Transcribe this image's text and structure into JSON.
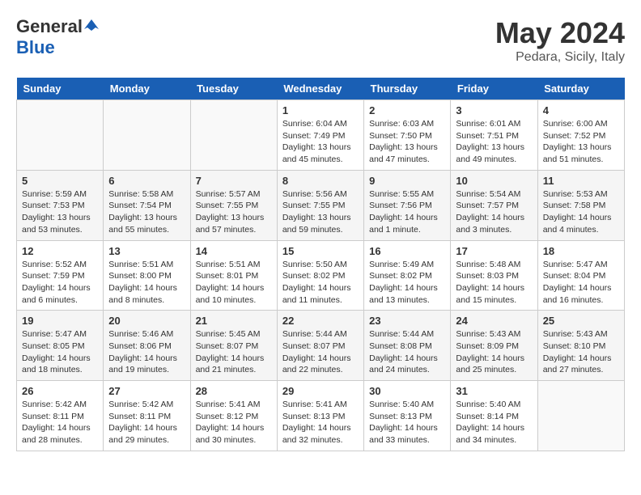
{
  "header": {
    "logo_general": "General",
    "logo_blue": "Blue",
    "title": "May 2024",
    "subtitle": "Pedara, Sicily, Italy"
  },
  "weekdays": [
    "Sunday",
    "Monday",
    "Tuesday",
    "Wednesday",
    "Thursday",
    "Friday",
    "Saturday"
  ],
  "weeks": [
    [
      {
        "day": "",
        "info": ""
      },
      {
        "day": "",
        "info": ""
      },
      {
        "day": "",
        "info": ""
      },
      {
        "day": "1",
        "info": "Sunrise: 6:04 AM\nSunset: 7:49 PM\nDaylight: 13 hours\nand 45 minutes."
      },
      {
        "day": "2",
        "info": "Sunrise: 6:03 AM\nSunset: 7:50 PM\nDaylight: 13 hours\nand 47 minutes."
      },
      {
        "day": "3",
        "info": "Sunrise: 6:01 AM\nSunset: 7:51 PM\nDaylight: 13 hours\nand 49 minutes."
      },
      {
        "day": "4",
        "info": "Sunrise: 6:00 AM\nSunset: 7:52 PM\nDaylight: 13 hours\nand 51 minutes."
      }
    ],
    [
      {
        "day": "5",
        "info": "Sunrise: 5:59 AM\nSunset: 7:53 PM\nDaylight: 13 hours\nand 53 minutes."
      },
      {
        "day": "6",
        "info": "Sunrise: 5:58 AM\nSunset: 7:54 PM\nDaylight: 13 hours\nand 55 minutes."
      },
      {
        "day": "7",
        "info": "Sunrise: 5:57 AM\nSunset: 7:55 PM\nDaylight: 13 hours\nand 57 minutes."
      },
      {
        "day": "8",
        "info": "Sunrise: 5:56 AM\nSunset: 7:55 PM\nDaylight: 13 hours\nand 59 minutes."
      },
      {
        "day": "9",
        "info": "Sunrise: 5:55 AM\nSunset: 7:56 PM\nDaylight: 14 hours\nand 1 minute."
      },
      {
        "day": "10",
        "info": "Sunrise: 5:54 AM\nSunset: 7:57 PM\nDaylight: 14 hours\nand 3 minutes."
      },
      {
        "day": "11",
        "info": "Sunrise: 5:53 AM\nSunset: 7:58 PM\nDaylight: 14 hours\nand 4 minutes."
      }
    ],
    [
      {
        "day": "12",
        "info": "Sunrise: 5:52 AM\nSunset: 7:59 PM\nDaylight: 14 hours\nand 6 minutes."
      },
      {
        "day": "13",
        "info": "Sunrise: 5:51 AM\nSunset: 8:00 PM\nDaylight: 14 hours\nand 8 minutes."
      },
      {
        "day": "14",
        "info": "Sunrise: 5:51 AM\nSunset: 8:01 PM\nDaylight: 14 hours\nand 10 minutes."
      },
      {
        "day": "15",
        "info": "Sunrise: 5:50 AM\nSunset: 8:02 PM\nDaylight: 14 hours\nand 11 minutes."
      },
      {
        "day": "16",
        "info": "Sunrise: 5:49 AM\nSunset: 8:02 PM\nDaylight: 14 hours\nand 13 minutes."
      },
      {
        "day": "17",
        "info": "Sunrise: 5:48 AM\nSunset: 8:03 PM\nDaylight: 14 hours\nand 15 minutes."
      },
      {
        "day": "18",
        "info": "Sunrise: 5:47 AM\nSunset: 8:04 PM\nDaylight: 14 hours\nand 16 minutes."
      }
    ],
    [
      {
        "day": "19",
        "info": "Sunrise: 5:47 AM\nSunset: 8:05 PM\nDaylight: 14 hours\nand 18 minutes."
      },
      {
        "day": "20",
        "info": "Sunrise: 5:46 AM\nSunset: 8:06 PM\nDaylight: 14 hours\nand 19 minutes."
      },
      {
        "day": "21",
        "info": "Sunrise: 5:45 AM\nSunset: 8:07 PM\nDaylight: 14 hours\nand 21 minutes."
      },
      {
        "day": "22",
        "info": "Sunrise: 5:44 AM\nSunset: 8:07 PM\nDaylight: 14 hours\nand 22 minutes."
      },
      {
        "day": "23",
        "info": "Sunrise: 5:44 AM\nSunset: 8:08 PM\nDaylight: 14 hours\nand 24 minutes."
      },
      {
        "day": "24",
        "info": "Sunrise: 5:43 AM\nSunset: 8:09 PM\nDaylight: 14 hours\nand 25 minutes."
      },
      {
        "day": "25",
        "info": "Sunrise: 5:43 AM\nSunset: 8:10 PM\nDaylight: 14 hours\nand 27 minutes."
      }
    ],
    [
      {
        "day": "26",
        "info": "Sunrise: 5:42 AM\nSunset: 8:11 PM\nDaylight: 14 hours\nand 28 minutes."
      },
      {
        "day": "27",
        "info": "Sunrise: 5:42 AM\nSunset: 8:11 PM\nDaylight: 14 hours\nand 29 minutes."
      },
      {
        "day": "28",
        "info": "Sunrise: 5:41 AM\nSunset: 8:12 PM\nDaylight: 14 hours\nand 30 minutes."
      },
      {
        "day": "29",
        "info": "Sunrise: 5:41 AM\nSunset: 8:13 PM\nDaylight: 14 hours\nand 32 minutes."
      },
      {
        "day": "30",
        "info": "Sunrise: 5:40 AM\nSunset: 8:13 PM\nDaylight: 14 hours\nand 33 minutes."
      },
      {
        "day": "31",
        "info": "Sunrise: 5:40 AM\nSunset: 8:14 PM\nDaylight: 14 hours\nand 34 minutes."
      },
      {
        "day": "",
        "info": ""
      }
    ]
  ]
}
